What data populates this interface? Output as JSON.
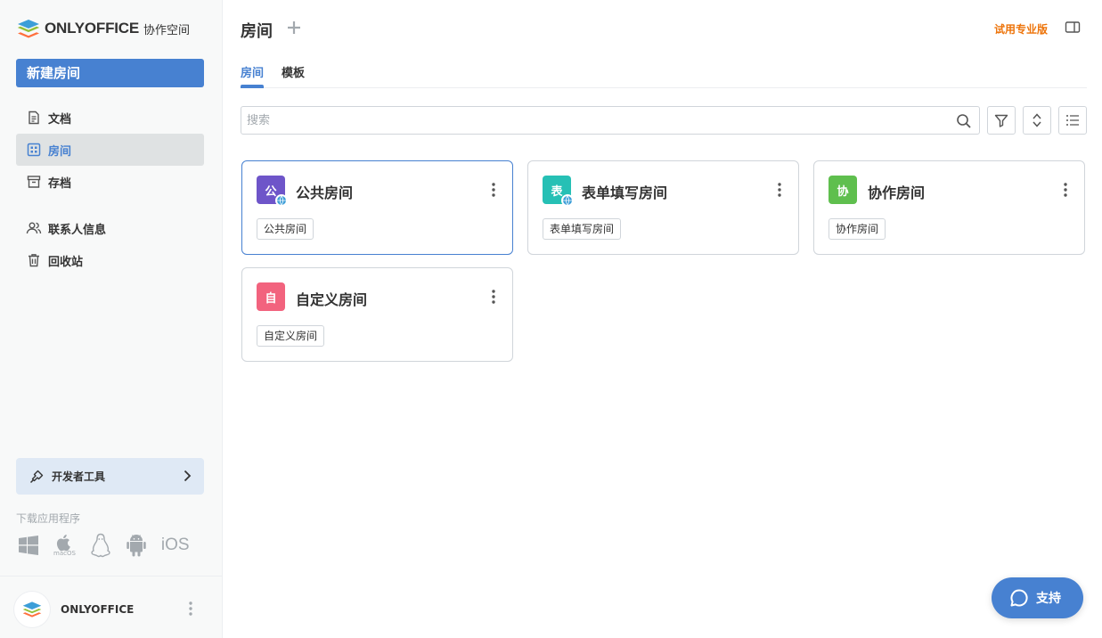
{
  "app": {
    "brand": "ONLYOFFICE",
    "brand_sub": "协作空间"
  },
  "sidebar": {
    "new_room_label": "新建房间",
    "items": [
      {
        "label": "文档",
        "icon": "document-icon",
        "active": false
      },
      {
        "label": "房间",
        "icon": "rooms-grid-icon",
        "active": true
      },
      {
        "label": "存档",
        "icon": "archive-icon",
        "active": false
      },
      {
        "label": "联系人信息",
        "icon": "contacts-icon",
        "active": false
      },
      {
        "label": "回收站",
        "icon": "trash-icon",
        "active": false
      }
    ],
    "dev_tools_label": "开发者工具",
    "download_label": "下载应用程序",
    "download_apps": {
      "windows": "windows-icon",
      "macos": "macOS",
      "linux": "linux-icon",
      "android": "android-icon",
      "ios": "iOS"
    },
    "profile_name": "ONLYOFFICE"
  },
  "header": {
    "title": "房间",
    "trial_label": "试用专业版"
  },
  "tabs": [
    {
      "label": "房间",
      "active": true
    },
    {
      "label": "模板",
      "active": false
    }
  ],
  "search": {
    "placeholder": "搜索"
  },
  "rooms": [
    {
      "name": "公共房间",
      "icon_letter": "公",
      "color": "#6e55c9",
      "tag": "公共房间",
      "public": true,
      "selected": true
    },
    {
      "name": "表单填写房间",
      "icon_letter": "表",
      "color": "#26c0b5",
      "tag": "表单填写房间",
      "public": true,
      "selected": false
    },
    {
      "name": "协作房间",
      "icon_letter": "协",
      "color": "#5fbf4e",
      "tag": "协作房间",
      "public": false,
      "selected": false
    },
    {
      "name": "自定义房间",
      "icon_letter": "自",
      "color": "#f2637e",
      "tag": "自定义房间",
      "public": false,
      "selected": false
    }
  ],
  "support_label": "支持",
  "colors": {
    "accent": "#4781d1",
    "trial": "#ed7309"
  }
}
